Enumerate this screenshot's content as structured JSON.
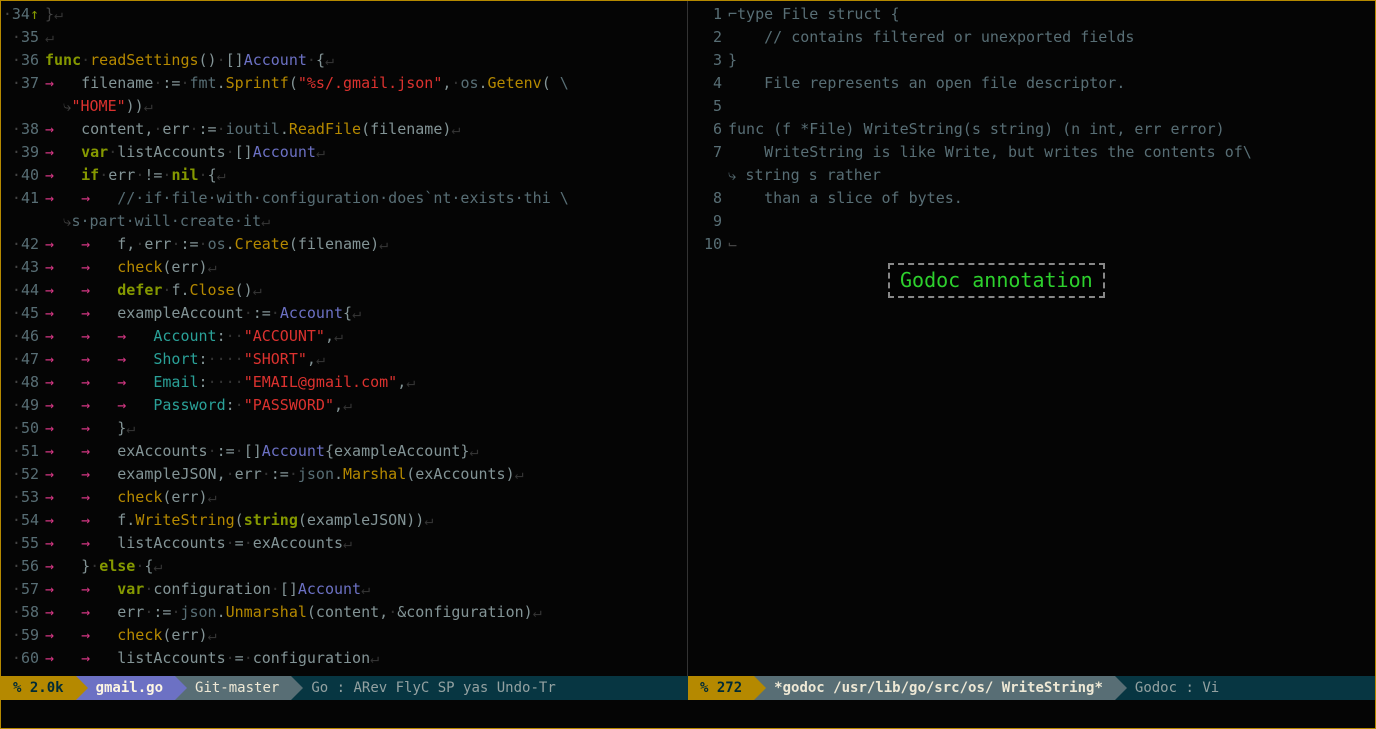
{
  "annotation_label": "Godoc annotation",
  "statusbar": {
    "left": {
      "percent": "% 2.0k",
      "filename": "gmail.go",
      "vc": "Git-master",
      "modes": "Go : ARev FlyC SP yas Undo-Tr"
    },
    "right": {
      "percent": "% 272",
      "buffer": "*godoc /usr/lib/go/src/os/ WriteString*",
      "modes": "Godoc : Vi"
    }
  },
  "left_lines": [
    {
      "n": "34",
      "up": "↑",
      "body": [
        [
          "mk",
          "}"
        ],
        [
          "nl",
          "↵"
        ]
      ]
    },
    {
      "n": "35",
      "body": [
        [
          "nl",
          "↵"
        ]
      ]
    },
    {
      "n": "36",
      "body": [
        [
          "kw",
          "func"
        ],
        [
          "ws",
          "·"
        ],
        [
          "fn",
          "readSettings"
        ],
        [
          "op",
          "()"
        ],
        [
          "ws",
          "·"
        ],
        [
          "op",
          "[]"
        ],
        [
          "ty",
          "Account"
        ],
        [
          "ws",
          "·"
        ],
        [
          "op",
          "{"
        ],
        [
          "nl",
          "↵"
        ]
      ]
    },
    {
      "n": "37",
      "body": [
        [
          "arrow",
          "→   "
        ],
        [
          "op",
          "filename"
        ],
        [
          "ws",
          "·"
        ],
        [
          "op",
          ":="
        ],
        [
          "ws",
          "·"
        ],
        [
          "pkg",
          "fmt"
        ],
        [
          "op",
          "."
        ],
        [
          "fn",
          "Sprintf"
        ],
        [
          "op",
          "("
        ],
        [
          "str",
          "\"%s/.gmail.json\""
        ],
        [
          "op",
          ","
        ],
        [
          "ws",
          "·"
        ],
        [
          "pkg",
          "os"
        ],
        [
          "op",
          "."
        ],
        [
          "fn",
          "Getenv"
        ],
        [
          "op",
          "("
        ],
        [
          "cm",
          " \\"
        ]
      ]
    },
    {
      "n": "",
      "wrap": true,
      "body": [
        [
          "wrapglyph",
          "  ⤷"
        ],
        [
          "str",
          "\"HOME\""
        ],
        [
          "op",
          "))"
        ],
        [
          "nl",
          "↵"
        ]
      ]
    },
    {
      "n": "38",
      "body": [
        [
          "arrow",
          "→   "
        ],
        [
          "op",
          "content,"
        ],
        [
          "ws",
          "·"
        ],
        [
          "op",
          "err"
        ],
        [
          "ws",
          "·"
        ],
        [
          "op",
          ":="
        ],
        [
          "ws",
          "·"
        ],
        [
          "pkg",
          "ioutil"
        ],
        [
          "op",
          "."
        ],
        [
          "fn",
          "ReadFile"
        ],
        [
          "op",
          "(filename)"
        ],
        [
          "nl",
          "↵"
        ]
      ]
    },
    {
      "n": "39",
      "body": [
        [
          "arrow",
          "→   "
        ],
        [
          "kw",
          "var"
        ],
        [
          "ws",
          "·"
        ],
        [
          "op",
          "listAccounts"
        ],
        [
          "ws",
          "·"
        ],
        [
          "op",
          "[]"
        ],
        [
          "ty",
          "Account"
        ],
        [
          "nl",
          "↵"
        ]
      ]
    },
    {
      "n": "40",
      "body": [
        [
          "arrow",
          "→   "
        ],
        [
          "kw",
          "if"
        ],
        [
          "ws",
          "·"
        ],
        [
          "op",
          "err"
        ],
        [
          "ws",
          "·"
        ],
        [
          "op",
          "!="
        ],
        [
          "ws",
          "·"
        ],
        [
          "kw",
          "nil"
        ],
        [
          "ws",
          "·"
        ],
        [
          "op",
          "{"
        ],
        [
          "nl",
          "↵"
        ]
      ]
    },
    {
      "n": "41",
      "body": [
        [
          "arrow",
          "→   "
        ],
        [
          "arrow",
          "→   "
        ],
        [
          "cm",
          "//·if·file·with·configuration·does`nt·exists·thi \\"
        ]
      ]
    },
    {
      "n": "",
      "wrap": true,
      "body": [
        [
          "wrapglyph",
          "  ⤷"
        ],
        [
          "cm",
          "s·part·will·create·it"
        ],
        [
          "nl",
          "↵"
        ]
      ]
    },
    {
      "n": "42",
      "body": [
        [
          "arrow",
          "→   "
        ],
        [
          "arrow",
          "→   "
        ],
        [
          "op",
          "f,"
        ],
        [
          "ws",
          "·"
        ],
        [
          "op",
          "err"
        ],
        [
          "ws",
          "·"
        ],
        [
          "op",
          ":="
        ],
        [
          "ws",
          "·"
        ],
        [
          "pkg",
          "os"
        ],
        [
          "op",
          "."
        ],
        [
          "fn",
          "Create"
        ],
        [
          "op",
          "(filename)"
        ],
        [
          "nl",
          "↵"
        ]
      ]
    },
    {
      "n": "43",
      "body": [
        [
          "arrow",
          "→   "
        ],
        [
          "arrow",
          "→   "
        ],
        [
          "fn",
          "check"
        ],
        [
          "op",
          "(err)"
        ],
        [
          "nl",
          "↵"
        ]
      ]
    },
    {
      "n": "44",
      "body": [
        [
          "arrow",
          "→   "
        ],
        [
          "arrow",
          "→   "
        ],
        [
          "kw",
          "defer"
        ],
        [
          "ws",
          "·"
        ],
        [
          "op",
          "f."
        ],
        [
          "fn",
          "Close"
        ],
        [
          "op",
          "()"
        ],
        [
          "nl",
          "↵"
        ]
      ]
    },
    {
      "n": "45",
      "body": [
        [
          "arrow",
          "→   "
        ],
        [
          "arrow",
          "→   "
        ],
        [
          "op",
          "exampleAccount"
        ],
        [
          "ws",
          "·"
        ],
        [
          "op",
          ":="
        ],
        [
          "ws",
          "·"
        ],
        [
          "ty",
          "Account"
        ],
        [
          "op",
          "{"
        ],
        [
          "nl",
          "↵"
        ]
      ]
    },
    {
      "n": "46",
      "body": [
        [
          "arrow",
          "→   "
        ],
        [
          "arrow",
          "→   "
        ],
        [
          "arrow",
          "→   "
        ],
        [
          "id",
          "Account"
        ],
        [
          "op",
          ":"
        ],
        [
          "ws",
          "··"
        ],
        [
          "str",
          "\"ACCOUNT\""
        ],
        [
          "op",
          ","
        ],
        [
          "nl",
          "↵"
        ]
      ]
    },
    {
      "n": "47",
      "body": [
        [
          "arrow",
          "→   "
        ],
        [
          "arrow",
          "→   "
        ],
        [
          "arrow",
          "→   "
        ],
        [
          "id",
          "Short"
        ],
        [
          "op",
          ":"
        ],
        [
          "ws",
          "····"
        ],
        [
          "str",
          "\"SHORT\""
        ],
        [
          "op",
          ","
        ],
        [
          "nl",
          "↵"
        ]
      ]
    },
    {
      "n": "48",
      "body": [
        [
          "arrow",
          "→   "
        ],
        [
          "arrow",
          "→   "
        ],
        [
          "arrow",
          "→   "
        ],
        [
          "id",
          "Email"
        ],
        [
          "op",
          ":"
        ],
        [
          "ws",
          "····"
        ],
        [
          "str",
          "\"EMAIL@gmail.com\""
        ],
        [
          "op",
          ","
        ],
        [
          "nl",
          "↵"
        ]
      ]
    },
    {
      "n": "49",
      "body": [
        [
          "arrow",
          "→   "
        ],
        [
          "arrow",
          "→   "
        ],
        [
          "arrow",
          "→   "
        ],
        [
          "id",
          "Password"
        ],
        [
          "op",
          ":"
        ],
        [
          "ws",
          "·"
        ],
        [
          "str",
          "\"PASSWORD\""
        ],
        [
          "op",
          ","
        ],
        [
          "nl",
          "↵"
        ]
      ]
    },
    {
      "n": "50",
      "body": [
        [
          "arrow",
          "→   "
        ],
        [
          "arrow",
          "→   "
        ],
        [
          "op",
          "}"
        ],
        [
          "nl",
          "↵"
        ]
      ]
    },
    {
      "n": "51",
      "body": [
        [
          "arrow",
          "→   "
        ],
        [
          "arrow",
          "→   "
        ],
        [
          "op",
          "exAccounts"
        ],
        [
          "ws",
          "·"
        ],
        [
          "op",
          ":="
        ],
        [
          "ws",
          "·"
        ],
        [
          "op",
          "[]"
        ],
        [
          "ty",
          "Account"
        ],
        [
          "op",
          "{exampleAccount}"
        ],
        [
          "nl",
          "↵"
        ]
      ]
    },
    {
      "n": "52",
      "body": [
        [
          "arrow",
          "→   "
        ],
        [
          "arrow",
          "→   "
        ],
        [
          "op",
          "exampleJSON,"
        ],
        [
          "ws",
          "·"
        ],
        [
          "op",
          "err"
        ],
        [
          "ws",
          "·"
        ],
        [
          "op",
          ":="
        ],
        [
          "ws",
          "·"
        ],
        [
          "pkg",
          "json"
        ],
        [
          "op",
          "."
        ],
        [
          "fn",
          "Marshal"
        ],
        [
          "op",
          "(exAccounts)"
        ],
        [
          "nl",
          "↵"
        ]
      ]
    },
    {
      "n": "53",
      "body": [
        [
          "arrow",
          "→   "
        ],
        [
          "arrow",
          "→   "
        ],
        [
          "fn",
          "check"
        ],
        [
          "op",
          "(err)"
        ],
        [
          "nl",
          "↵"
        ]
      ]
    },
    {
      "n": "54",
      "body": [
        [
          "arrow",
          "→   "
        ],
        [
          "arrow",
          "→   "
        ],
        [
          "op",
          "f."
        ],
        [
          "fn",
          "WriteString"
        ],
        [
          "op",
          "("
        ],
        [
          "kw",
          "string"
        ],
        [
          "op",
          "(exampleJSON))"
        ],
        [
          "nl",
          "↵"
        ]
      ]
    },
    {
      "n": "55",
      "body": [
        [
          "arrow",
          "→   "
        ],
        [
          "arrow",
          "→   "
        ],
        [
          "op",
          "listAccounts"
        ],
        [
          "ws",
          "·"
        ],
        [
          "op",
          "="
        ],
        [
          "ws",
          "·"
        ],
        [
          "op",
          "exAccounts"
        ],
        [
          "nl",
          "↵"
        ]
      ]
    },
    {
      "n": "56",
      "body": [
        [
          "arrow",
          "→   "
        ],
        [
          "op",
          "}"
        ],
        [
          "ws",
          "·"
        ],
        [
          "kw",
          "else"
        ],
        [
          "ws",
          "·"
        ],
        [
          "op",
          "{"
        ],
        [
          "nl",
          "↵"
        ]
      ]
    },
    {
      "n": "57",
      "body": [
        [
          "arrow",
          "→   "
        ],
        [
          "arrow",
          "→   "
        ],
        [
          "kw",
          "var"
        ],
        [
          "ws",
          "·"
        ],
        [
          "op",
          "configuration"
        ],
        [
          "ws",
          "·"
        ],
        [
          "op",
          "[]"
        ],
        [
          "ty",
          "Account"
        ],
        [
          "nl",
          "↵"
        ]
      ]
    },
    {
      "n": "58",
      "body": [
        [
          "arrow",
          "→   "
        ],
        [
          "arrow",
          "→   "
        ],
        [
          "op",
          "err"
        ],
        [
          "ws",
          "·"
        ],
        [
          "op",
          ":="
        ],
        [
          "ws",
          "·"
        ],
        [
          "pkg",
          "json"
        ],
        [
          "op",
          "."
        ],
        [
          "fn",
          "Unmarshal"
        ],
        [
          "op",
          "(content,"
        ],
        [
          "ws",
          "·"
        ],
        [
          "op",
          "&configuration)"
        ],
        [
          "nl",
          "↵"
        ]
      ]
    },
    {
      "n": "59",
      "body": [
        [
          "arrow",
          "→   "
        ],
        [
          "arrow",
          "→   "
        ],
        [
          "fn",
          "check"
        ],
        [
          "op",
          "(err)"
        ],
        [
          "nl",
          "↵"
        ]
      ]
    },
    {
      "n": "60",
      "body": [
        [
          "arrow",
          "→   "
        ],
        [
          "arrow",
          "→   "
        ],
        [
          "op",
          "listAccounts"
        ],
        [
          "ws",
          "·"
        ],
        [
          "op",
          "="
        ],
        [
          "ws",
          "·"
        ],
        [
          "op",
          "configuration"
        ],
        [
          "nl",
          "↵"
        ]
      ]
    }
  ],
  "right_lines": [
    {
      "n": "1",
      "text": "⌐type File struct {",
      "cls": "doc"
    },
    {
      "n": "2",
      "text": "    // contains filtered or unexported fields",
      "cls": "doc"
    },
    {
      "n": "3",
      "text": "}",
      "cls": "doc"
    },
    {
      "n": "4",
      "text": "    File represents an open file descriptor.",
      "cls": "doc"
    },
    {
      "n": "5",
      "text": "",
      "cls": "doc"
    },
    {
      "n": "6",
      "text": "func (f *File) WriteString(s string) (n int, err error)",
      "cls": "docg"
    },
    {
      "n": "7",
      "text": "    WriteString is like Write, but writes the contents of\\",
      "cls": "doc"
    },
    {
      "n": "",
      "text": "⤷ string s rather",
      "cls": "doc",
      "wrap": true
    },
    {
      "n": "8",
      "text": "    than a slice of bytes.",
      "cls": "doc"
    },
    {
      "n": "9",
      "text": "",
      "cls": "doc"
    },
    {
      "n": "10",
      "text": "⌙",
      "cls": "mk"
    }
  ]
}
